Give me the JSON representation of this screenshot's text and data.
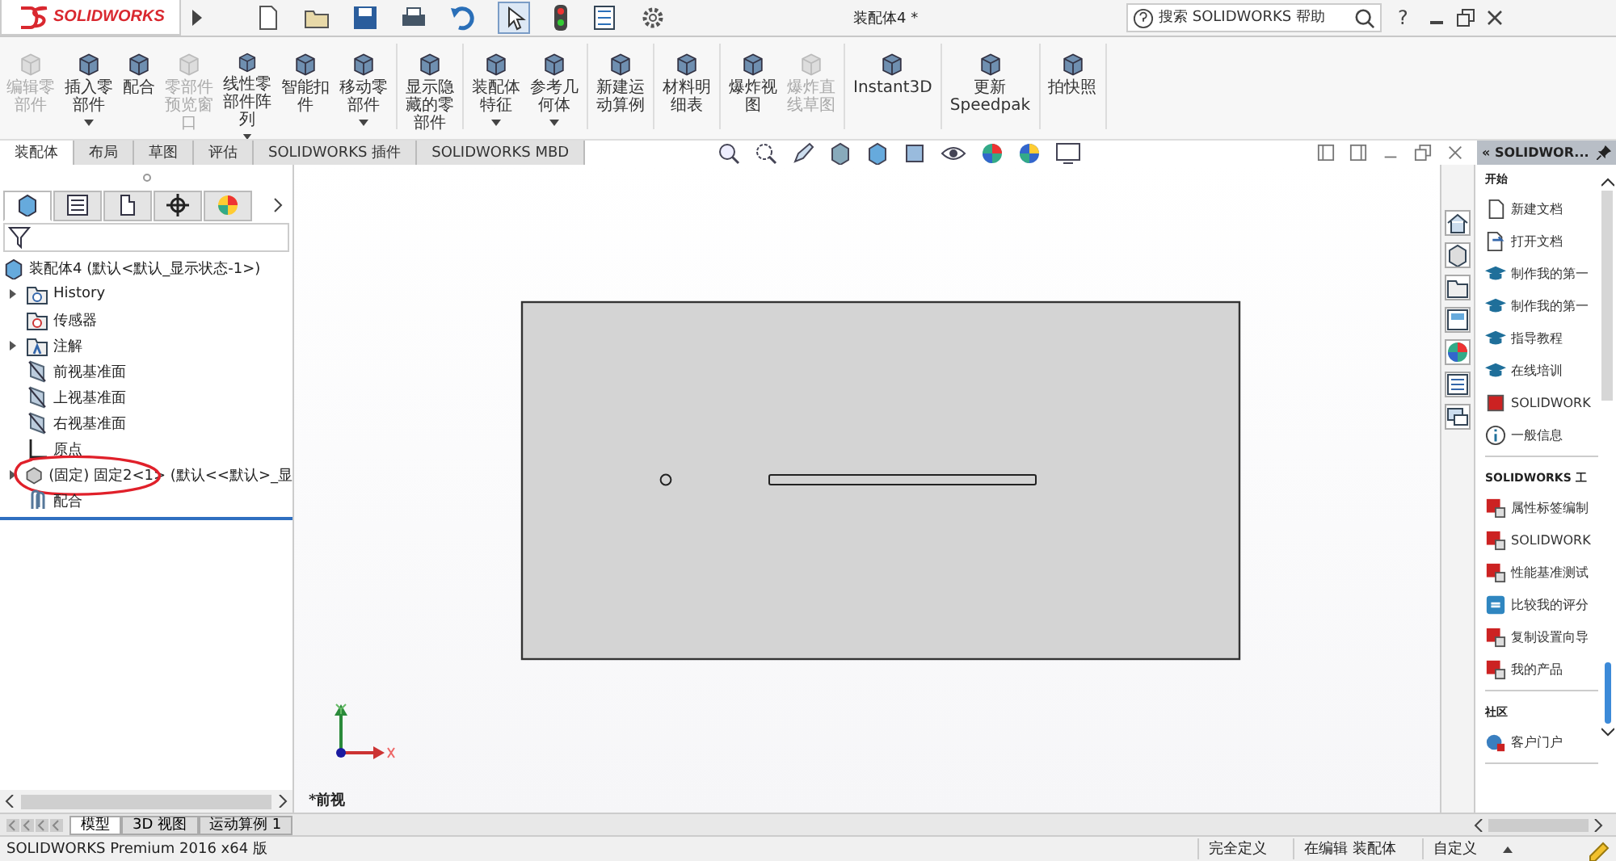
{
  "title_bar": {
    "logo": "SOLIDWORKS",
    "document_title": "装配体4 *",
    "search_placeholder": "搜索 SOLIDWORKS 帮助",
    "help": "?"
  },
  "ribbon": {
    "groups": [
      [
        {
          "lines": [
            "编辑零",
            "部件"
          ],
          "disabled": true,
          "dropdown": false
        },
        {
          "lines": [
            "插入零",
            "部件"
          ],
          "disabled": false,
          "dropdown": true
        },
        {
          "lines": [
            "配合"
          ],
          "disabled": false,
          "dropdown": false
        },
        {
          "lines": [
            "零部件",
            "预览窗",
            "口"
          ],
          "disabled": true,
          "dropdown": false
        },
        {
          "lines": [
            "线性零",
            "部件阵",
            "列"
          ],
          "disabled": false,
          "dropdown": true
        },
        {
          "lines": [
            "智能扣",
            "件"
          ],
          "disabled": false,
          "dropdown": false
        },
        {
          "lines": [
            "移动零",
            "部件"
          ],
          "disabled": false,
          "dropdown": true
        }
      ],
      [
        {
          "lines": [
            "显示隐",
            "藏的零",
            "部件"
          ],
          "disabled": false,
          "dropdown": false
        }
      ],
      [
        {
          "lines": [
            "装配体",
            "特征"
          ],
          "disabled": false,
          "dropdown": true
        },
        {
          "lines": [
            "参考几",
            "何体"
          ],
          "disabled": false,
          "dropdown": true
        }
      ],
      [
        {
          "lines": [
            "新建运",
            "动算例"
          ],
          "disabled": false,
          "dropdown": false
        }
      ],
      [
        {
          "lines": [
            "材料明",
            "细表"
          ],
          "disabled": false,
          "dropdown": false
        }
      ],
      [
        {
          "lines": [
            "爆炸视",
            "图"
          ],
          "disabled": false,
          "dropdown": false
        },
        {
          "lines": [
            "爆炸直",
            "线草图"
          ],
          "disabled": true,
          "dropdown": false
        }
      ],
      [
        {
          "lines": [
            "Instant3D"
          ],
          "disabled": false,
          "dropdown": false
        }
      ],
      [
        {
          "lines": [
            "更新",
            "Speedpak"
          ],
          "disabled": false,
          "dropdown": false
        }
      ],
      [
        {
          "lines": [
            "拍快照"
          ],
          "disabled": false,
          "dropdown": false
        }
      ]
    ]
  },
  "command_tabs": [
    {
      "label": "装配体",
      "selected": true
    },
    {
      "label": "布局",
      "selected": false
    },
    {
      "label": "草图",
      "selected": false
    },
    {
      "label": "评估",
      "selected": false
    },
    {
      "label": "SOLIDWORKS 插件",
      "selected": false
    },
    {
      "label": "SOLIDWORKS MBD",
      "selected": false
    }
  ],
  "manager_tabs": [
    {
      "selected": true
    },
    {
      "selected": false
    },
    {
      "selected": false
    },
    {
      "selected": false
    },
    {
      "selected": false
    }
  ],
  "feature_tree": {
    "label": "装配体4  (默认<默认_显示状态-1>)",
    "children": [
      {
        "label": "History",
        "expanded": false,
        "kind": "history"
      },
      {
        "label": "传感器",
        "kind": "sensor"
      },
      {
        "label": "注解",
        "expanded": false,
        "kind": "annotation"
      },
      {
        "label": "前视基准面",
        "kind": "plane"
      },
      {
        "label": "上视基准面",
        "kind": "plane"
      },
      {
        "label": "右视基准面",
        "kind": "plane"
      },
      {
        "label": "原点",
        "kind": "origin"
      },
      {
        "label": "(固定) 固定2<1> (默认<<默认>_显",
        "expanded": false,
        "kind": "part",
        "circled": true
      },
      {
        "label": "配合",
        "kind": "mate"
      }
    ]
  },
  "view": {
    "orientation_label": "*前视"
  },
  "task_pane": {
    "title": "« SOLIDWOR...",
    "sections": [
      {
        "heading": "开始",
        "items": [
          {
            "label": "新建文档",
            "kind": "document"
          },
          {
            "label": "打开文档",
            "kind": "open"
          },
          {
            "label": "制作我的第一",
            "kind": "course"
          },
          {
            "label": "制作我的第一",
            "kind": "course"
          },
          {
            "label": "指导教程",
            "kind": "course"
          },
          {
            "label": "在线培训",
            "kind": "course"
          },
          {
            "label": "SOLIDWORK",
            "kind": "product"
          },
          {
            "label": "一般信息",
            "kind": "info"
          }
        ]
      },
      {
        "heading": "SOLIDWORKS 工",
        "items": [
          {
            "label": "属性标签编制",
            "kind": "tool"
          },
          {
            "label": "SOLIDWORK",
            "kind": "tool"
          },
          {
            "label": "性能基准测试",
            "kind": "tool"
          },
          {
            "label": "比较我的评分",
            "kind": "compare"
          },
          {
            "label": "复制设置向导",
            "kind": "tool"
          },
          {
            "label": "我的产品",
            "kind": "tool"
          }
        ]
      },
      {
        "heading": "社区",
        "items": [
          {
            "label": "客户门户",
            "kind": "portal"
          }
        ]
      }
    ]
  },
  "model_tabs": [
    {
      "label": "模型",
      "selected": true
    },
    {
      "label": "3D 视图",
      "selected": false
    },
    {
      "label": "运动算例 1",
      "selected": false
    }
  ],
  "status_bar": {
    "product": "SOLIDWORKS Premium 2016 x64 版",
    "fields": [
      "完全定义",
      "在编辑 装配体",
      "自定义"
    ]
  }
}
